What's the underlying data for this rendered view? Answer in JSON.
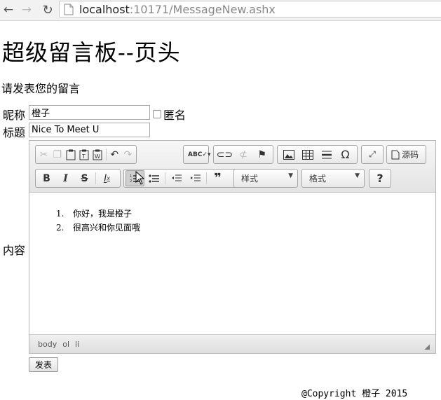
{
  "browser": {
    "url_host": "localhost",
    "url_rest": ":10171/MessageNew.ashx",
    "back_icon": "←",
    "forward_icon": "→",
    "reload_icon": "↻"
  },
  "page": {
    "title": "超级留言板--页头",
    "intro": "请发表您的留言"
  },
  "form": {
    "nickname_label": "昵称",
    "nickname_value": "橙子",
    "anonymous_label": "匿名",
    "anonymous_checked": false,
    "title_label": "标题",
    "title_value": "Nice To Meet U",
    "content_label": "内容",
    "submit_label": "发表"
  },
  "editor": {
    "source_label": "源码",
    "style_label": "样式",
    "format_label": "格式",
    "help_label": "?",
    "content_items": [
      "你好，我是橙子",
      "很高兴和你见面哦"
    ],
    "content_numbers": [
      "1.",
      "2."
    ],
    "path": [
      "body",
      "ol",
      "li"
    ]
  },
  "footer": {
    "copyright": "@Copyright 橙子 2015"
  },
  "colors": {
    "toolbar_bg": "#e8e8e8",
    "border": "#b6b6b6"
  }
}
